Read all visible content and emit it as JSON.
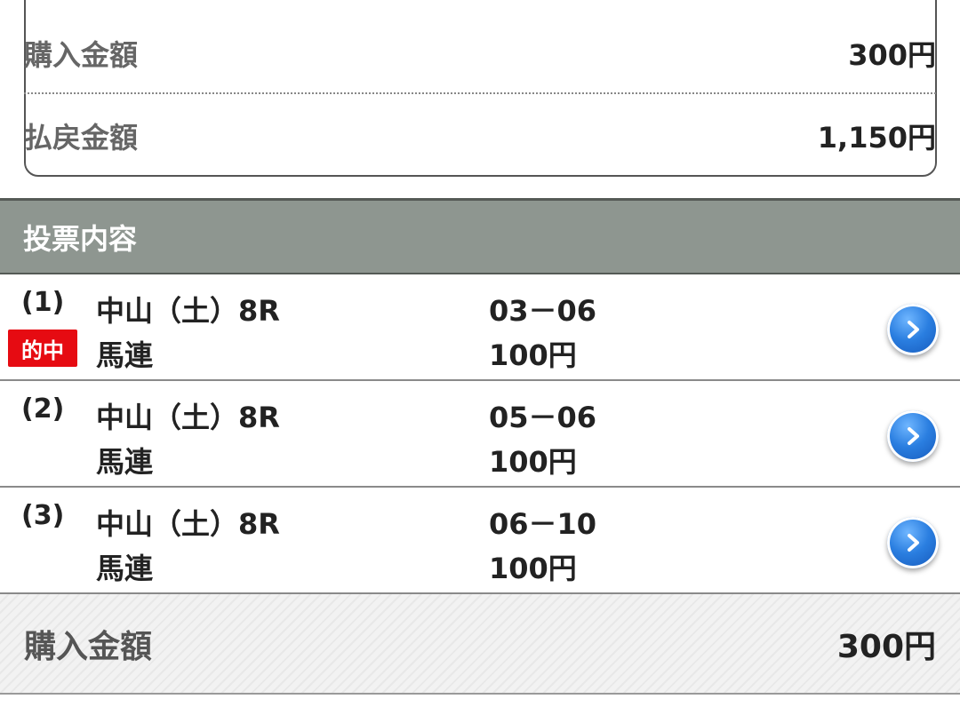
{
  "summary": {
    "purchase_label": "購入金額",
    "purchase_value": "300円",
    "payout_label": "払戻金額",
    "payout_value": "1,150円"
  },
  "section": {
    "title": "投票内容"
  },
  "tickets": [
    {
      "number": "(1)",
      "badge": "的中",
      "race": "中山（土）8R",
      "bet_type": "馬連",
      "combination": "03－06",
      "amount": "100円"
    },
    {
      "number": "(2)",
      "race": "中山（土）8R",
      "bet_type": "馬連",
      "combination": "05－06",
      "amount": "100円"
    },
    {
      "number": "(3)",
      "race": "中山（土）8R",
      "bet_type": "馬連",
      "combination": "06－10",
      "amount": "100円"
    }
  ],
  "footer": {
    "purchase_label": "購入金額",
    "purchase_value": "300円"
  },
  "colors": {
    "hit_badge": "#e60b12",
    "header_bg": "#8e9690",
    "detail_button": "#2a7ee0"
  },
  "icons": {
    "detail": "chevron-right-circle-icon"
  }
}
